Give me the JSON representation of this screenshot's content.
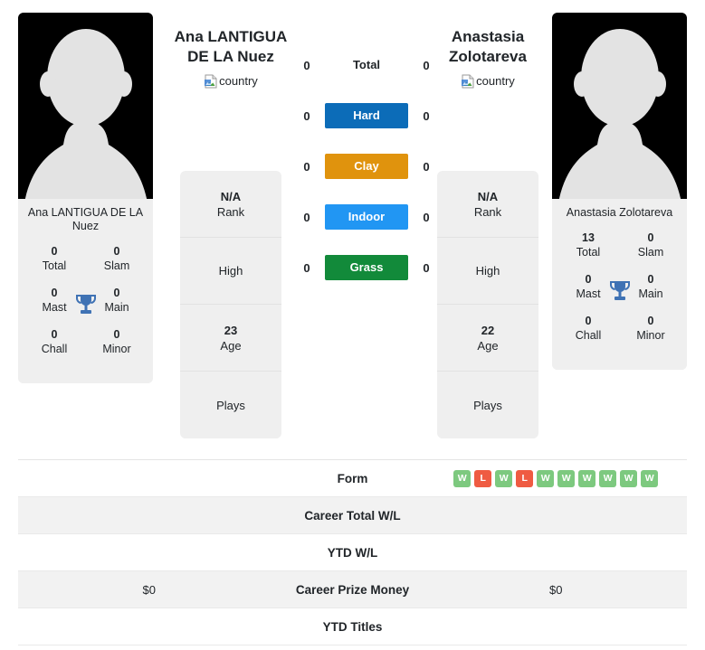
{
  "players": {
    "left": {
      "display_name_line1": "Ana LANTIGUA",
      "display_name_line2": "DE LA Nuez",
      "card_name": "Ana LANTIGUA DE LA Nuez",
      "country_alt": "country",
      "avatar_icon": "player-placeholder-silhouette",
      "titles": {
        "total_value": "0",
        "total_label": "Total",
        "slam_value": "0",
        "slam_label": "Slam",
        "mast_value": "0",
        "mast_label": "Mast",
        "main_value": "0",
        "main_label": "Main",
        "chall_value": "0",
        "chall_label": "Chall",
        "minor_value": "0",
        "minor_label": "Minor",
        "trophy_icon": "trophy-icon"
      },
      "info": [
        {
          "value": "N/A",
          "label": "Rank"
        },
        {
          "value": "",
          "label": "High"
        },
        {
          "value": "23",
          "label": "Age"
        },
        {
          "value": "",
          "label": "Plays"
        }
      ]
    },
    "right": {
      "display_name_line1": "Anastasia",
      "display_name_line2": "Zolotareva",
      "card_name": "Anastasia Zolotareva",
      "country_alt": "country",
      "avatar_icon": "player-placeholder-silhouette",
      "titles": {
        "total_value": "13",
        "total_label": "Total",
        "slam_value": "0",
        "slam_label": "Slam",
        "mast_value": "0",
        "mast_label": "Mast",
        "main_value": "0",
        "main_label": "Main",
        "chall_value": "0",
        "chall_label": "Chall",
        "minor_value": "0",
        "minor_label": "Minor",
        "trophy_icon": "trophy-icon"
      },
      "info": [
        {
          "value": "N/A",
          "label": "Rank"
        },
        {
          "value": "",
          "label": "High"
        },
        {
          "value": "22",
          "label": "Age"
        },
        {
          "value": "",
          "label": "Plays"
        }
      ]
    }
  },
  "surfaces": [
    {
      "label": "Total",
      "left": "0",
      "right": "0",
      "color": "transparent",
      "plain": true
    },
    {
      "label": "Hard",
      "left": "0",
      "right": "0",
      "color": "#0c6cb8",
      "plain": false
    },
    {
      "label": "Clay",
      "left": "0",
      "right": "0",
      "color": "#e0930d",
      "plain": false
    },
    {
      "label": "Indoor",
      "left": "0",
      "right": "0",
      "color": "#2196f3",
      "plain": false
    },
    {
      "label": "Grass",
      "left": "0",
      "right": "0",
      "color": "#128a3a",
      "plain": false
    }
  ],
  "table": [
    {
      "label": "Form",
      "left": "",
      "right": "",
      "shaded": false,
      "right_is_form": true
    },
    {
      "label": "Career Total W/L",
      "left": "",
      "right": "",
      "shaded": true,
      "right_is_form": false
    },
    {
      "label": "YTD W/L",
      "left": "",
      "right": "",
      "shaded": false,
      "right_is_form": false
    },
    {
      "label": "Career Prize Money",
      "left": "$0",
      "right": "$0",
      "shaded": true,
      "right_is_form": false
    },
    {
      "label": "YTD Titles",
      "left": "",
      "right": "",
      "shaded": false,
      "right_is_form": false
    }
  ],
  "form": {
    "results": [
      "W",
      "L",
      "W",
      "L",
      "W",
      "W",
      "W",
      "W",
      "W",
      "W"
    ],
    "win_color": "#7dc97f",
    "loss_color": "#ef5b42"
  },
  "colors": {
    "card_bg": "#efefef",
    "row_shaded": "#f2f2f2",
    "text": "#212529",
    "trophy": "#3f72b4"
  }
}
